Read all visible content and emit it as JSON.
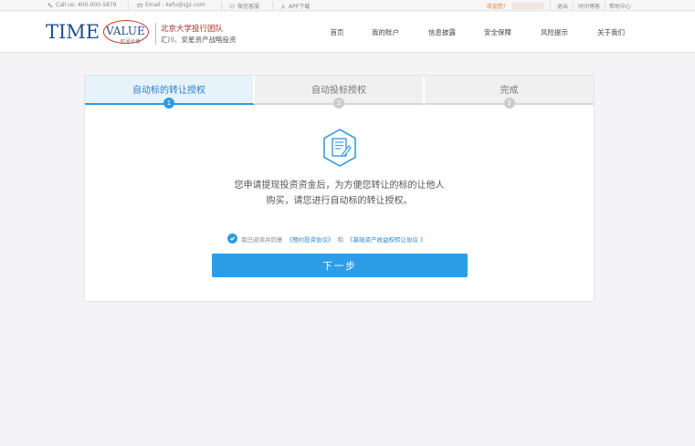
{
  "topbar": {
    "phone": "Call us: 400-000-5879",
    "email": "Email : kefu@sjjz.com",
    "wechat": "微信客服",
    "app": "APP下载",
    "welcome": "欢迎您！",
    "logout": "退出",
    "blog": "时间博客",
    "help": "帮助中心"
  },
  "logo": {
    "time": "TIME",
    "value": "VALUE",
    "cn": "时间价值"
  },
  "slogan": {
    "line1": "北京大学投行团队",
    "line2": "汇川、安星资产战略投资"
  },
  "nav": [
    {
      "label": "首页"
    },
    {
      "label": "我的账户"
    },
    {
      "label": "信息披露"
    },
    {
      "label": "安全保障"
    },
    {
      "label": "风险提示"
    },
    {
      "label": "关于我们"
    }
  ],
  "steps": [
    {
      "label": "自动标的转让授权",
      "num": "1",
      "active": true
    },
    {
      "label": "自动投标授权",
      "num": "2",
      "active": false
    },
    {
      "label": "完成",
      "num": "3",
      "active": false
    }
  ],
  "description": {
    "line1": "您申请提现投资资金后，为方便您转让的标的让他人",
    "line2": "购买，请您进行自动标的转让授权。"
  },
  "agreement": {
    "prefix": "我已阅读并同意",
    "link1": "《预约投资协议》",
    "and": "和",
    "link2": "《基础资产收益权转让协议 》",
    "checked": true
  },
  "next_button": "下一步",
  "colors": {
    "accent": "#2c9ee8",
    "brand_blue": "#1f4f8c",
    "brand_red": "#c8362d",
    "welcome": "#e8762c"
  }
}
